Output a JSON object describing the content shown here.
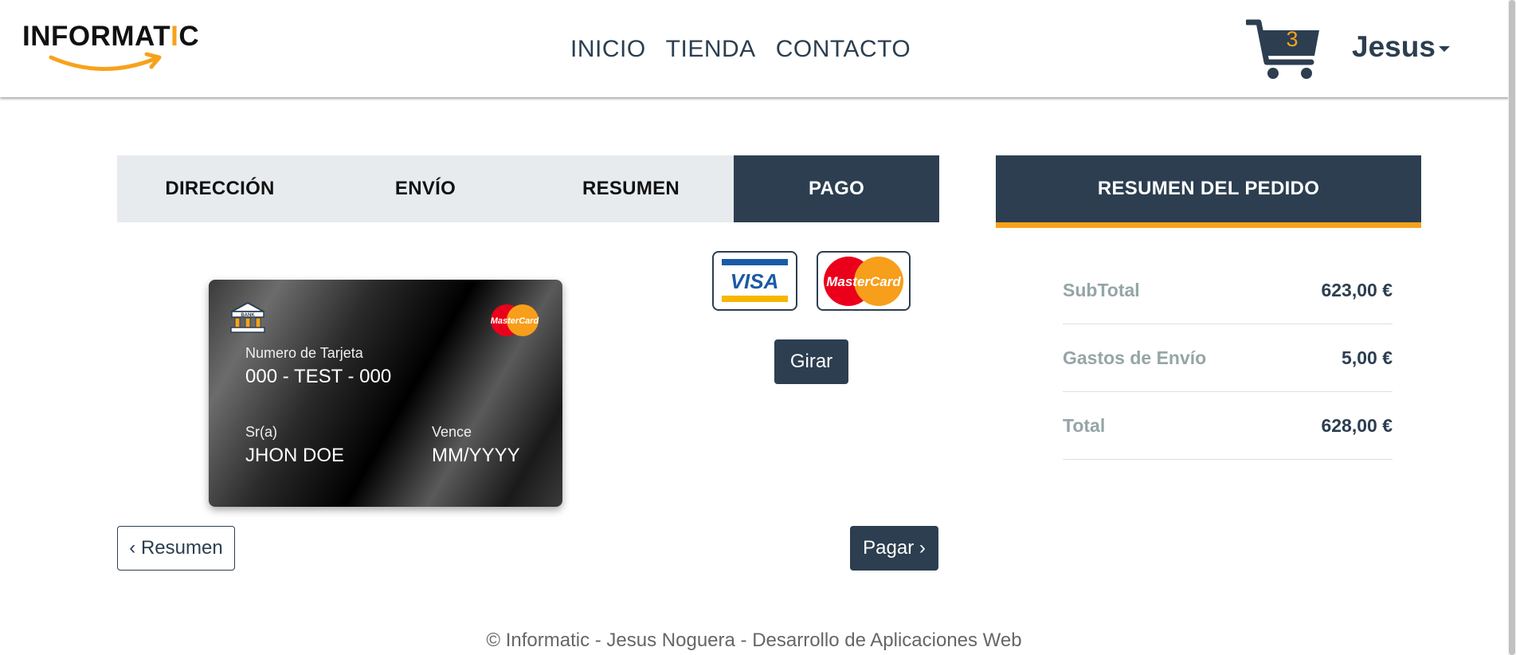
{
  "brand": {
    "logo_prefix": "INFORMAT",
    "logo_i": "I",
    "logo_suffix": "C",
    "accent": "#f7a21b",
    "primary": "#2c3e50"
  },
  "nav": {
    "items": [
      {
        "label": "INICIO"
      },
      {
        "label": "TIENDA"
      },
      {
        "label": "CONTACTO"
      }
    ]
  },
  "cart": {
    "count": "3",
    "icon": "shopping-cart-icon"
  },
  "user": {
    "name": "Jesus"
  },
  "steps": [
    {
      "label": "DIRECCIÓN"
    },
    {
      "label": "ENVÍO"
    },
    {
      "label": "RESUMEN"
    },
    {
      "label": "PAGO",
      "active": true
    }
  ],
  "card": {
    "number_label": "Numero de Tarjeta",
    "number_value": "000 - TEST - 000",
    "holder_label": "Sr(a)",
    "holder_value": "JHON DOE",
    "expiry_label": "Vence",
    "expiry_value": "MM/YYYY",
    "bank_text": "BANK",
    "brand_text": "MasterCard"
  },
  "payment_methods": {
    "visa": "VISA",
    "mastercard": "MasterCard"
  },
  "buttons": {
    "rotate": "Girar",
    "back": "Resumen",
    "pay": "Pagar"
  },
  "summary": {
    "title": "RESUMEN DEL PEDIDO",
    "rows": [
      {
        "label": "SubTotal",
        "value": "623,00 €"
      },
      {
        "label": "Gastos de Envío",
        "value": "5,00 €"
      },
      {
        "label": "Total",
        "value": "628,00 €"
      }
    ]
  },
  "footer": {
    "text": "© Informatic - Jesus Noguera - Desarrollo de Aplicaciones Web"
  }
}
